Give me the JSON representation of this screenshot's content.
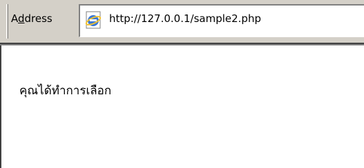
{
  "toolbar": {
    "address_label": "Address",
    "url": "http://127.0.0.1/sample2.php",
    "page_icon": "internet-explorer-page-icon"
  },
  "page": {
    "text": "คุณได้ทำการเลือก"
  }
}
